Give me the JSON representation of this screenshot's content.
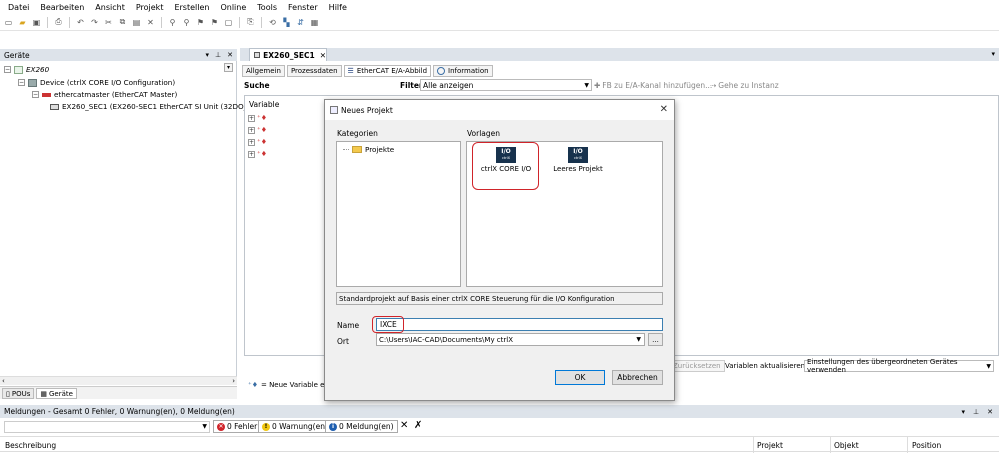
{
  "menu": [
    "Datei",
    "Bearbeiten",
    "Ansicht",
    "Projekt",
    "Erstellen",
    "Online",
    "Tools",
    "Fenster",
    "Hilfe"
  ],
  "devices": {
    "title": "Geräte",
    "tree": [
      {
        "label": "EX260",
        "italic": true
      },
      {
        "label": "Device (ctrlX CORE I/O Configuration)"
      },
      {
        "label": "ethercatmaster (EtherCAT Master)"
      },
      {
        "label": "EX260_SEC1 (EX260-SEC1 EtherCAT SI Unit (32DO_PN"
      }
    ],
    "tabs": [
      "POUs",
      "Geräte"
    ]
  },
  "editor": {
    "doc_tab": "EX260_SEC1",
    "subtabs": [
      "Allgemein",
      "Prozessdaten",
      "EtherCAT E/A-Abbild",
      "Information"
    ],
    "search_label": "Suche",
    "filter_label": "Filter",
    "filter_value": "Alle anzeigen",
    "fb_add": "FB zu E/A-Kanal hinzufügen...",
    "goto_instance": "Gehe zu Instanz",
    "variable_header": "Variable",
    "map_button": "Zurücksetzen",
    "update_label": "Variablen aktualisieren",
    "update_value": "Einstellungen des übergeordneten Gerätes verwenden",
    "new_var": "= Neue Variable erz"
  },
  "messages": {
    "title": "Meldungen - Gesamt 0 Fehler, 0 Warnung(en), 0 Meldung(en)",
    "errors": "0 Fehler",
    "warnings": "0 Warnung(en)",
    "infos": "0 Meldung(en)",
    "columns": [
      "Beschreibung",
      "Projekt",
      "Objekt",
      "Position"
    ]
  },
  "dialog": {
    "title": "Neues Projekt",
    "categories_label": "Kategorien",
    "templates_label": "Vorlagen",
    "category_item": "Projekte",
    "templates": [
      {
        "badge": "I/O",
        "badge_sub": "ctrlX",
        "label": "ctrlX CORE I/O"
      },
      {
        "badge": "I/O",
        "badge_sub": "ctrlX",
        "label": "Leeres Projekt"
      }
    ],
    "description": "Standardprojekt auf Basis einer ctrlX CORE Steuerung für die I/O Konfiguration",
    "name_label": "Name",
    "name_value": "IXCE",
    "location_label": "Ort",
    "location_value": "C:\\Users\\IAC-CAD\\Documents\\My ctrlX",
    "browse_label": "...",
    "ok_label": "OK",
    "cancel_label": "Abbrechen"
  },
  "colors": {
    "highlight": "#d0242a",
    "panel_header": "#dde3ea",
    "badge": "#17324d"
  }
}
